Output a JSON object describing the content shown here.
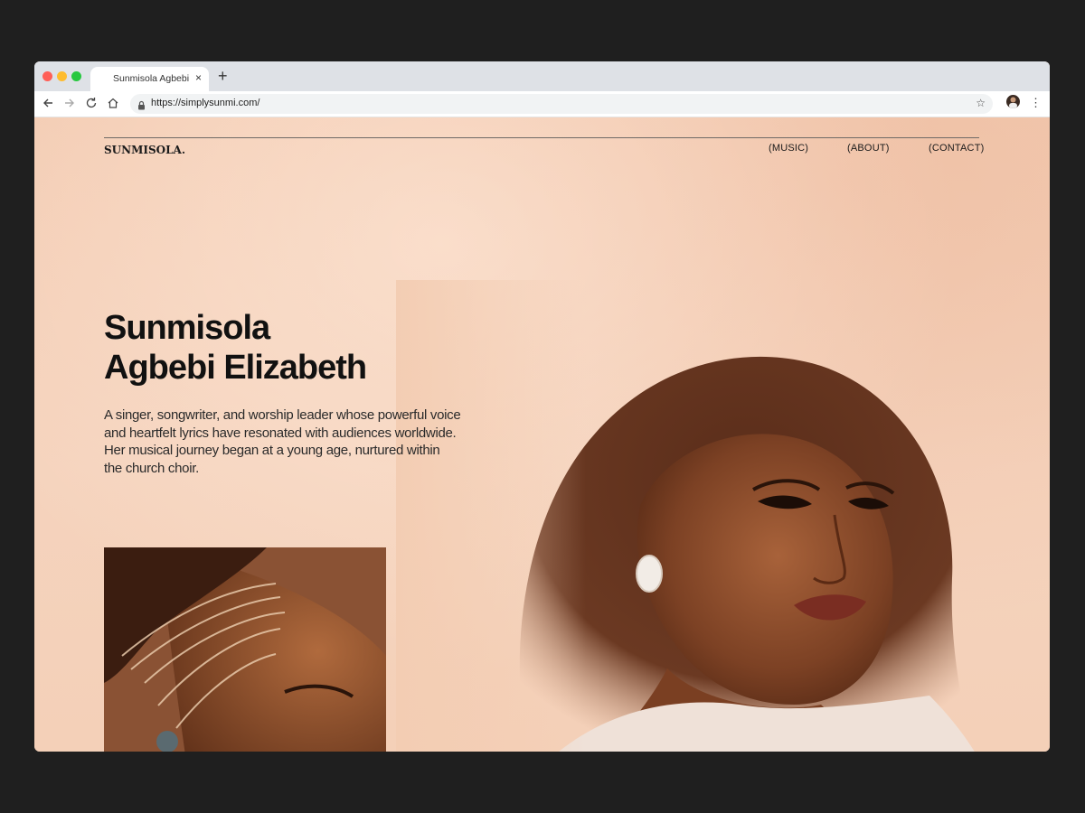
{
  "browser": {
    "tab_title": "Sunmisola Agbebi",
    "tab_close": "×",
    "new_tab": "+",
    "url": "https://simplysunmi.com/"
  },
  "site": {
    "logo": "SUNMISOLA.",
    "nav": {
      "music": "(MUSIC)",
      "about": "(ABOUT)",
      "contact": "(CONTACT)"
    },
    "hero": {
      "title_line1": "Sunmisola",
      "title_line2": "Agbebi Elizabeth",
      "description": "A singer, songwriter, and worship leader whose powerful voice and heartfelt lyrics have resonated with audiences worldwide. Her musical journey began at a young age, nurtured within the church choir."
    }
  },
  "colors": {
    "page_background": "#f3cdb3",
    "text": "#111111",
    "desktop": "#1f1f1f"
  }
}
